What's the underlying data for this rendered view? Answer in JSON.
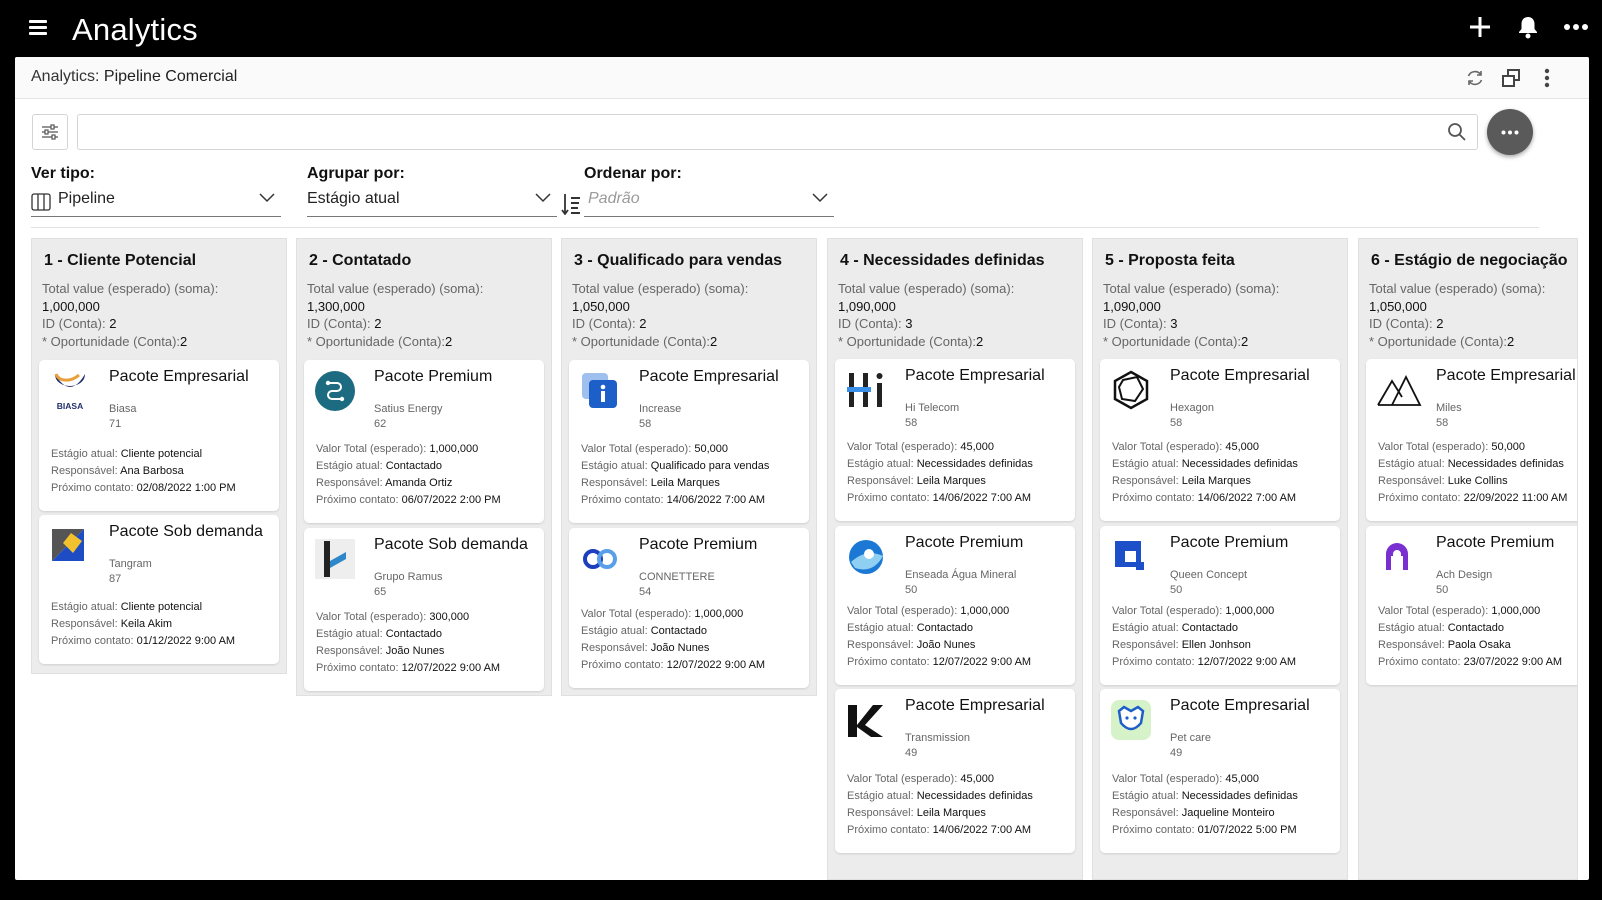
{
  "app": {
    "title": "Analytics"
  },
  "window": {
    "title_prefix": "Analytics:",
    "title": "Pipeline Comercial"
  },
  "search": {
    "value": "",
    "placeholder": ""
  },
  "controls": {
    "view_label": "Ver tipo:",
    "view_value": "Pipeline",
    "group_label": "Agrupar por:",
    "group_value": "Estágio atual",
    "sort_label": "Ordenar por:",
    "sort_placeholder": "Padrão"
  },
  "labels": {
    "total": "Total value (esperado) (soma):",
    "id": "ID (Conta):",
    "opp": "* Oportunidade (Conta):",
    "valor": "Valor Total (esperado):",
    "estagio": "Estágio atual:",
    "resp": "Responsável:",
    "prox": "Próximo contato:"
  },
  "columns": [
    {
      "title": "1 - Cliente Potencial",
      "total": "1,000,000",
      "id_count": "2",
      "opp_count": "2",
      "cards": [
        {
          "product": "Pacote Empresarial",
          "company": "Biasa",
          "score": "71",
          "logo": "biasa-logo",
          "logo_text": "BIASA",
          "stage": "Cliente potencial",
          "owner": "Ana Barbosa",
          "next": "02/08/2022 1:00 PM"
        },
        {
          "product": "Pacote Sob demanda",
          "company": "Tangram",
          "score": "87",
          "logo": "tangram-logo",
          "stage": "Cliente potencial",
          "owner": "Keila Akim",
          "next": "01/12/2022 9:00 AM"
        }
      ]
    },
    {
      "title": "2 - Contatado",
      "total": "1,300,000",
      "id_count": "2",
      "opp_count": "2",
      "cards": [
        {
          "product": "Pacote Premium",
          "company": "Satius Energy",
          "score": "62",
          "logo": "satius-logo",
          "value": "1,000,000",
          "stage": "Contactado",
          "owner": "Amanda Ortiz",
          "next": "06/07/2022 2:00 PM"
        },
        {
          "product": "Pacote Sob demanda",
          "company": "Grupo Ramus",
          "score": "65",
          "logo": "ramus-logo",
          "value": "300,000",
          "stage": "Contactado",
          "owner": "João Nunes",
          "next": "12/07/2022 9:00 AM"
        }
      ]
    },
    {
      "title": "3 - Qualificado para vendas",
      "total": "1,050,000",
      "id_count": "2",
      "opp_count": "2",
      "cards": [
        {
          "product": "Pacote Empresarial",
          "company": "Increase",
          "score": "58",
          "logo": "increase-logo",
          "value": "50,000",
          "stage": "Qualificado para vendas",
          "owner": "Leila Marques",
          "next": "14/06/2022 7:00 AM"
        },
        {
          "product": "Pacote Premium",
          "company": "CONNETTERE",
          "score": "54",
          "logo": "connettere-logo",
          "value": "1,000,000",
          "stage": "Contactado",
          "owner": "João Nunes",
          "next": "12/07/2022 9:00 AM"
        }
      ]
    },
    {
      "title": "4 - Necessidades definidas",
      "total": "1,090,000",
      "id_count": "3",
      "opp_count": "2",
      "cards": [
        {
          "product": "Pacote Empresarial",
          "company": "Hi Telecom",
          "score": "58",
          "logo": "hi-telecom-logo",
          "value": "45,000",
          "stage": "Necessidades definidas",
          "owner": "Leila Marques",
          "next": "14/06/2022 7:00 AM"
        },
        {
          "product": "Pacote Premium",
          "company": "Enseada Água Mineral",
          "score": "50",
          "logo": "enseada-logo",
          "value": "1,000,000",
          "stage": "Contactado",
          "owner": "João Nunes",
          "next": "12/07/2022 9:00 AM"
        },
        {
          "product": "Pacote Empresarial",
          "company": "Transmission",
          "score": "49",
          "logo": "transmission-logo",
          "value": "45,000",
          "stage": "Necessidades definidas",
          "owner": "Leila Marques",
          "next": "14/06/2022 7:00 AM"
        }
      ]
    },
    {
      "title": "5 - Proposta feita",
      "total": "1,090,000",
      "id_count": "3",
      "opp_count": "2",
      "cards": [
        {
          "product": "Pacote Empresarial",
          "company": "Hexagon",
          "score": "58",
          "logo": "hexagon-logo",
          "value": "45,000",
          "stage": "Necessidades definidas",
          "owner": "Leila Marques",
          "next": "14/06/2022 7:00 AM"
        },
        {
          "product": "Pacote Premium",
          "company": "Queen Concept",
          "score": "50",
          "logo": "queen-concept-logo",
          "value": "1,000,000",
          "stage": "Contactado",
          "owner": "Ellen Jonhson",
          "next": "12/07/2022 9:00 AM"
        },
        {
          "product": "Pacote Empresarial",
          "company": "Pet care",
          "score": "49",
          "logo": "pet-care-logo",
          "value": "45,000",
          "stage": "Necessidades definidas",
          "owner": "Jaqueline Monteiro",
          "next": "01/07/2022 5:00 PM"
        }
      ]
    },
    {
      "title": "6 - Estágio de negociação",
      "total": "1,050,000",
      "id_count": "2",
      "opp_count": "2",
      "cards": [
        {
          "product": "Pacote Empresarial",
          "company": "Miles",
          "score": "58",
          "logo": "miles-logo",
          "value": "50,000",
          "stage": "Necessidades definidas",
          "owner": "Luke Collins",
          "next": "22/09/2022 11:00 AM"
        },
        {
          "product": "Pacote Premium",
          "company": "Ach Design",
          "score": "50",
          "logo": "ach-design-logo",
          "value": "1,000,000",
          "stage": "Contactado",
          "owner": "Paola Osaka",
          "next": "23/07/2022 9:00 AM"
        }
      ]
    }
  ]
}
